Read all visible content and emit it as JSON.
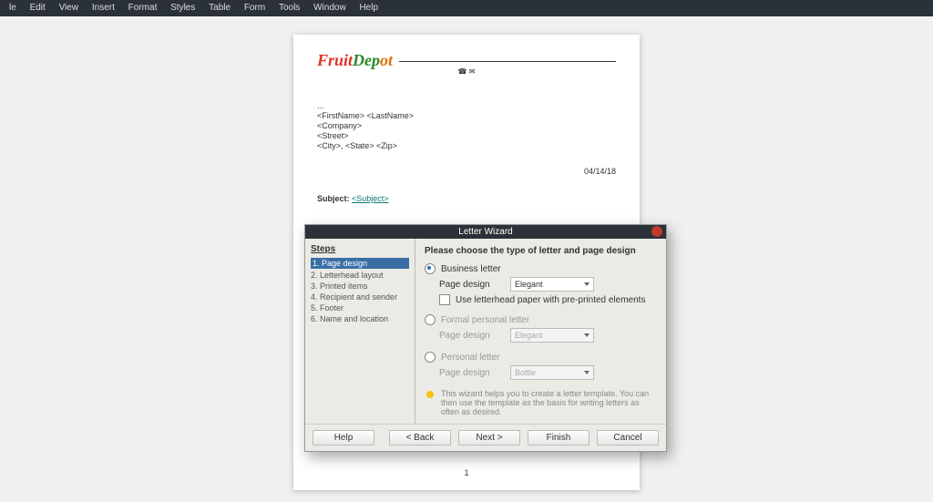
{
  "menu": {
    "items": [
      "le",
      "Edit",
      "View",
      "Insert",
      "Format",
      "Styles",
      "Table",
      "Form",
      "Tools",
      "Window",
      "Help"
    ]
  },
  "doc": {
    "logo_a": "Fruit",
    "logo_b": "Dep",
    "logo_c": "ot",
    "symbol": "☎ ✉",
    "ellipsis": "...",
    "fields": [
      "<FirstName> <LastName>",
      "<Company>",
      "<Street>",
      "<City>, <State> <Zip>"
    ],
    "date": "04/14/18",
    "subject_label": "Subject: ",
    "subject_link": "<Subject>",
    "page_num": "1"
  },
  "wizard": {
    "title": "Letter Wizard",
    "steps_title": "Steps",
    "steps": [
      "1. Page design",
      "2. Letterhead layout",
      "3. Printed items",
      "4. Recipient and sender",
      "5. Footer",
      "6. Name and location"
    ],
    "heading": "Please choose the type of letter and page design",
    "opt1": {
      "label": "Business letter",
      "page_design": "Page design",
      "value": "Elegant",
      "pre": "Use letterhead paper with pre-printed elements"
    },
    "opt2": {
      "label": "Formal personal letter",
      "page_design": "Page design",
      "value": "Elegant"
    },
    "opt3": {
      "label": "Personal letter",
      "page_design": "Page design",
      "value": "Bottle"
    },
    "hint": "This wizard helps you to create a letter template. You can then use the template as the basis for writing letters as often as desired.",
    "buttons": {
      "help": "Help",
      "back": "< Back",
      "next": "Next >",
      "finish": "Finish",
      "cancel": "Cancel"
    }
  }
}
